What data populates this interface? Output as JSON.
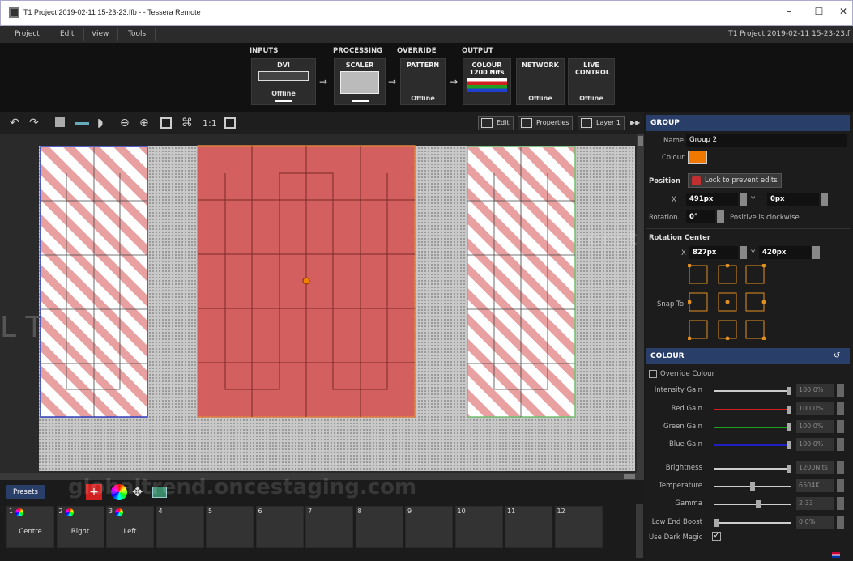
{
  "window": {
    "title": "T1 Project 2019-02-11 15-23-23.ffb - - Tessera Remote",
    "min": "–",
    "max": "☐",
    "close": "✕"
  },
  "menu": {
    "items": [
      "Project",
      "Edit",
      "View",
      "Tools"
    ],
    "project_name": "T1 Project 2019-02-11 15-23-23.f"
  },
  "pipeline": {
    "headers": {
      "inputs": "INPUTS",
      "processing": "PROCESSING",
      "override": "OVERRIDE",
      "output": "OUTPUT"
    },
    "dvi": {
      "label": "DVI",
      "status": "Offline"
    },
    "scaler": {
      "label": "SCALER"
    },
    "pattern": {
      "label": "PATTERN",
      "status": "Offline"
    },
    "colour": {
      "label": "COLOUR",
      "sub": "1200 Nits"
    },
    "network": {
      "label": "NETWORK",
      "status": "Offline"
    },
    "live": {
      "label": "LIVE CONTROL",
      "status": "Offline"
    }
  },
  "toolbar": {
    "edit": "Edit",
    "properties": "Properties",
    "layer": "Layer 1",
    "one_to_one": "1:1",
    "expand": "▶▶"
  },
  "group": {
    "header": "GROUP",
    "name_label": "Name",
    "name_value": "Group 2",
    "colour_label": "Colour",
    "colour_value": "#f07800",
    "position_label": "Position",
    "lock_label": "Lock to prevent edits",
    "x_label": "X",
    "x_value": "491px",
    "y_label": "Y",
    "y_value": "0px",
    "rotation_label": "Rotation",
    "rotation_value": "0°",
    "rotation_hint": "Positive is clockwise",
    "rotation_center_label": "Rotation Center",
    "rc_x_label": "X",
    "rc_x_value": "827px",
    "rc_y_label": "Y",
    "rc_y_value": "420px",
    "snap_label": "Snap To"
  },
  "colour": {
    "header": "COLOUR",
    "override_label": "Override Colour",
    "rows": [
      {
        "label": "Intensity Gain",
        "value": "100.0%",
        "color": "#cccccc",
        "level": 1.0
      },
      {
        "label": "Red Gain",
        "value": "100.0%",
        "color": "#d02020",
        "level": 1.0
      },
      {
        "label": "Green Gain",
        "value": "100.0%",
        "color": "#20a020",
        "level": 1.0
      },
      {
        "label": "Blue Gain",
        "value": "100.0%",
        "color": "#2020c0",
        "level": 1.0
      },
      {
        "label": "Brightness",
        "value": "1200Nits",
        "color": "#cccccc",
        "level": 1.0
      },
      {
        "label": "Temperature",
        "value": "6504K",
        "color": "#cccccc",
        "level": 0.5
      },
      {
        "label": "Gamma",
        "value": "2.33",
        "color": "#cccccc",
        "level": 0.58
      },
      {
        "label": "Low End Boost",
        "value": "0.0%",
        "color": "#cccccc",
        "level": 0.0
      }
    ],
    "dark_magic_label": "Use Dark Magic"
  },
  "presets": {
    "tab": "Presets",
    "cells": [
      {
        "n": "1",
        "label": "Centre"
      },
      {
        "n": "2",
        "label": "Right"
      },
      {
        "n": "3",
        "label": "Left"
      },
      {
        "n": "4",
        "label": ""
      },
      {
        "n": "5",
        "label": ""
      },
      {
        "n": "6",
        "label": ""
      },
      {
        "n": "7",
        "label": ""
      },
      {
        "n": "8",
        "label": ""
      },
      {
        "n": "9",
        "label": ""
      },
      {
        "n": "10",
        "label": ""
      },
      {
        "n": "11",
        "label": ""
      },
      {
        "n": "12",
        "label": ""
      }
    ]
  },
  "watermarks": [
    "reestaging.com",
    "globaltrend.oncestaging.com"
  ]
}
